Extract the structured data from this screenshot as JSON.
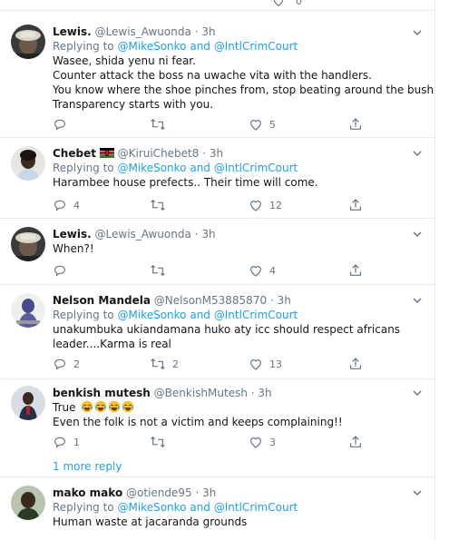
{
  "colors": {
    "accent": "#1da1f2",
    "text": "#14171a",
    "muted": "#657786",
    "border": "#e6ecf0"
  },
  "icons": {
    "reply": "reply-icon",
    "retweet": "retweet-icon",
    "like": "like-icon",
    "share": "share-icon",
    "more": "chevron-down-icon"
  },
  "top_strip": {
    "count": "0"
  },
  "tweets": [
    {
      "name": "Lewis.",
      "handle": "@Lewis_Awuonda",
      "time": "3h",
      "replying_prefix": "Replying to",
      "mention1": "@MikeSonko",
      "and": "and",
      "mention2": "@IntlCrimCourt",
      "lines": [
        "Wasee, shida yenu ni fear.",
        "Counter attack the boss na uwache vita with the handlers.",
        "You know where the shoe pinches from, stop beating around the bush.",
        "Transparency starts with you."
      ],
      "replies": "",
      "retweets": "",
      "likes": "5"
    },
    {
      "name": "Chebet",
      "handle": "@KiruiChebet8",
      "time": "3h",
      "replying_prefix": "Replying to",
      "mention1": "@MikeSonko",
      "and": "and",
      "mention2": "@IntlCrimCourt",
      "lines": [
        "Harambee house prefects.. Their time will come."
      ],
      "replies": "4",
      "retweets": "",
      "likes": "12"
    },
    {
      "name": "Lewis.",
      "handle": "@Lewis_Awuonda",
      "time": "3h",
      "lines": [
        "When?!"
      ],
      "replies": "",
      "retweets": "",
      "likes": "4"
    },
    {
      "name": "Nelson Mandela",
      "handle": "@NelsonM53885870",
      "time": "3h",
      "replying_prefix": "Replying to",
      "mention1": "@MikeSonko",
      "and": "and",
      "mention2": "@IntlCrimCourt",
      "lines": [
        "unakumbuka ukiandamana huko aty icc should respect africans",
        "leader....Karma is real"
      ],
      "replies": "2",
      "retweets": "2",
      "likes": "13"
    },
    {
      "name": "benkish mutesh",
      "handle": "@BenkishMutesh",
      "time": "3h",
      "lines": [
        "True",
        "Even the folk is not a victim and keeps complaining!!"
      ],
      "replies": "1",
      "retweets": "",
      "likes": "3"
    },
    {
      "name": "mako mako",
      "handle": "@otiende95",
      "time": "3h",
      "replying_prefix": "Replying to",
      "mention1": "@MikeSonko",
      "and": "and",
      "mention2": "@IntlCrimCourt",
      "lines": [
        "Human waste at jacaranda grounds"
      ]
    }
  ],
  "more_replies": "1 more reply"
}
